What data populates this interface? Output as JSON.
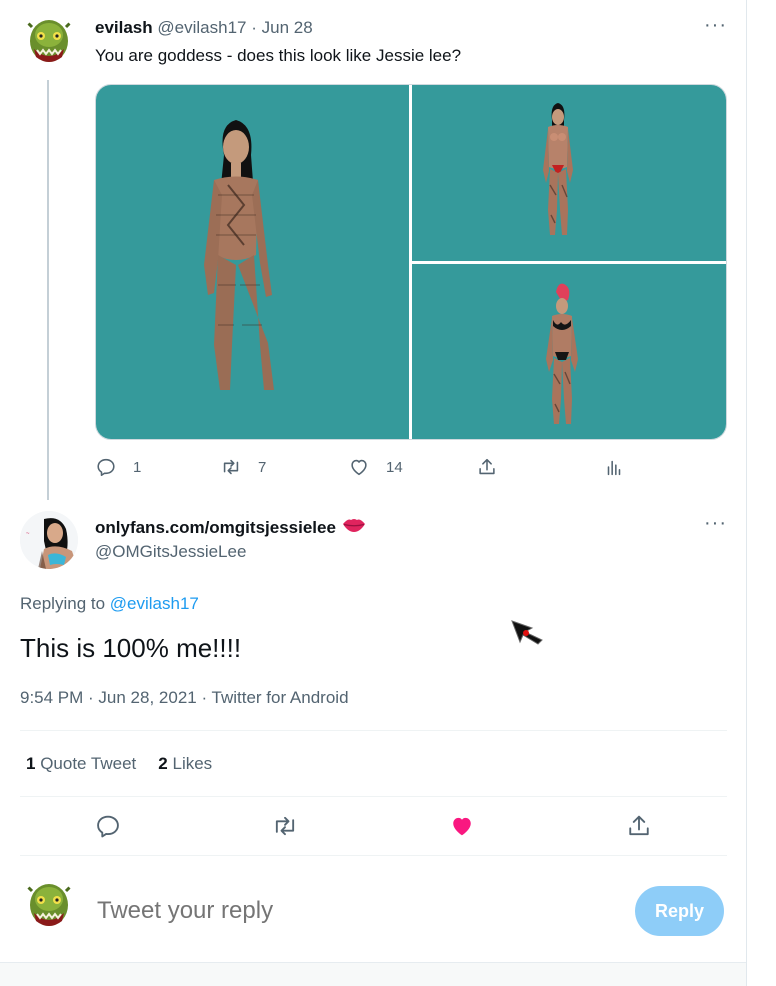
{
  "parent_tweet": {
    "display_name": "evilash",
    "handle": "@evilash17",
    "separator": "·",
    "date": "Jun 28",
    "text": "You are goddess - does this look like Jessie lee?",
    "more_icon": "more-dots-icon",
    "media_background": "#359a9b",
    "actions": {
      "reply_count": "1",
      "retweet_count": "7",
      "like_count": "14"
    }
  },
  "main_tweet": {
    "display_name": "onlyfans.com/omgitsjessielee",
    "name_emoji_icon": "kiss-lips-icon",
    "handle": "@OMGitsJessieLee",
    "replying_prefix": "Replying to ",
    "replying_mention": "@evilash17",
    "text": "This is 100% me!!!!",
    "meta": "9:54 PM · Jun 28, 2021 · Twitter for Android",
    "stats": {
      "quote_count": "1",
      "quote_label": "Quote Tweet",
      "like_count": "2",
      "like_label": "Likes"
    },
    "liked": true
  },
  "reply_box": {
    "placeholder": "Tweet your reply",
    "button_label": "Reply"
  },
  "colors": {
    "accent": "#1d9bf0",
    "like": "#f91880",
    "muted_text": "#536471",
    "reply_button_disabled": "#8ecdf8"
  }
}
